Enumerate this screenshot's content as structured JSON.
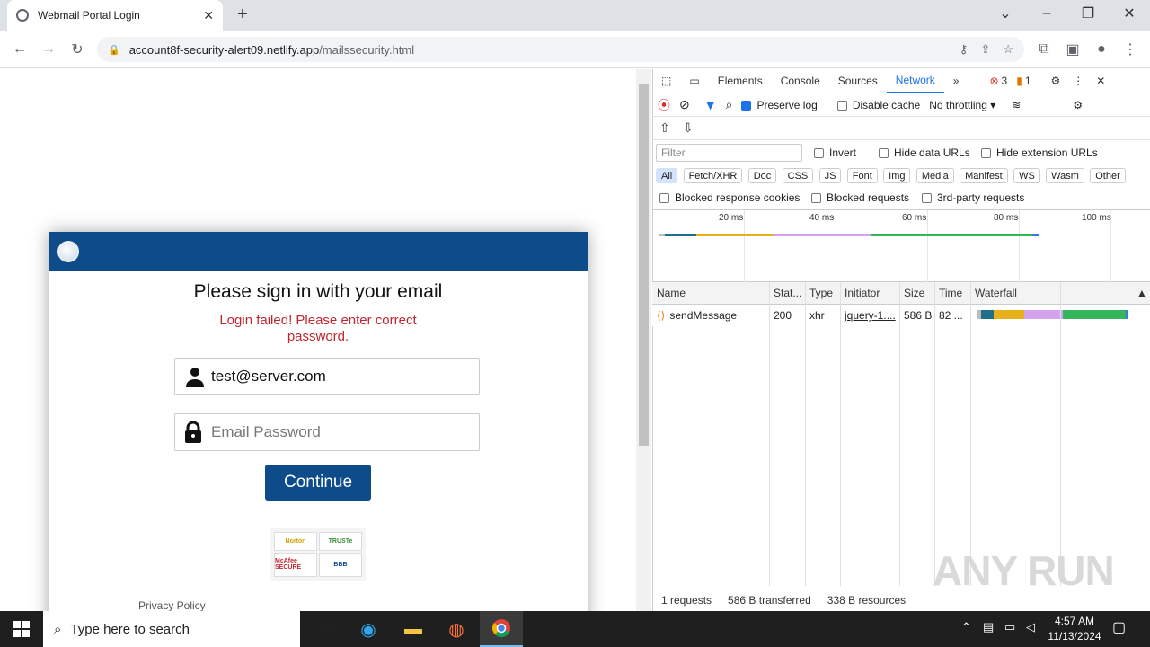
{
  "browser": {
    "tab_title": "Webmail Portal Login",
    "url_host": "account8f-security-alert09.netlify.app",
    "url_path": "/mailssecurity.html"
  },
  "login": {
    "heading": "Please sign in with your email",
    "error": "Login failed! Please enter correct password.",
    "email_value": "test@server.com",
    "password_placeholder": "Email Password",
    "continue_label": "Continue",
    "seals": [
      "Norton",
      "TRUSTe",
      "McAfee SECURE",
      "BBB"
    ],
    "privacy_label": "Privacy Policy"
  },
  "devtools": {
    "tabs": [
      "Elements",
      "Console",
      "Sources",
      "Network"
    ],
    "active_tab": "Network",
    "error_count": "3",
    "warning_count": "1",
    "preserve_log": "Preserve log",
    "disable_cache": "Disable cache",
    "throttling": "No throttling",
    "filter_placeholder": "Filter",
    "invert": "Invert",
    "hide_data_urls": "Hide data URLs",
    "hide_ext_urls": "Hide extension URLs",
    "type_filters": [
      "All",
      "Fetch/XHR",
      "Doc",
      "CSS",
      "JS",
      "Font",
      "Img",
      "Media",
      "Manifest",
      "WS",
      "Wasm",
      "Other"
    ],
    "blocked_cookies": "Blocked response cookies",
    "blocked_requests": "Blocked requests",
    "third_party": "3rd-party requests",
    "ticks": [
      "20 ms",
      "40 ms",
      "60 ms",
      "80 ms",
      "100 ms"
    ],
    "columns": [
      "Name",
      "Stat...",
      "Type",
      "Initiator",
      "Size",
      "Time",
      "Waterfall"
    ],
    "row": {
      "name": "sendMessage",
      "status": "200",
      "type": "xhr",
      "initiator": "jquery-1....",
      "size": "586 B",
      "time": "82 ..."
    },
    "status_requests": "1 requests",
    "status_transferred": "586 B transferred",
    "status_resources": "338 B resources"
  },
  "watermark": "ANY RUN",
  "taskbar": {
    "search_placeholder": "Type here to search",
    "time": "4:57 AM",
    "date": "11/13/2024"
  }
}
